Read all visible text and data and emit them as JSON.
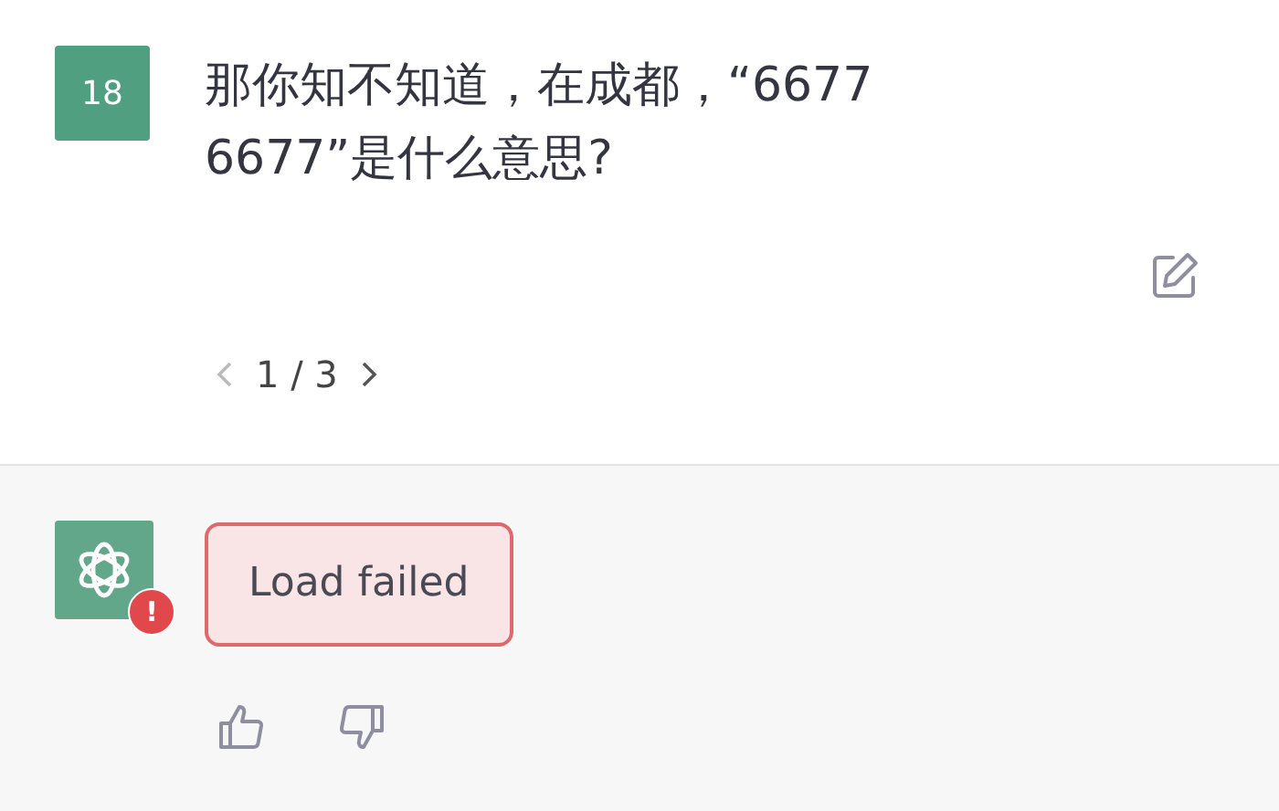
{
  "user_message": {
    "avatar": "18",
    "text": "那你知不知道，在成都，“6677 6677”是什么意思?"
  },
  "pagination": {
    "current": "1 / 3"
  },
  "assistant_message": {
    "error_badge": "!",
    "error_text": "Load failed"
  }
}
